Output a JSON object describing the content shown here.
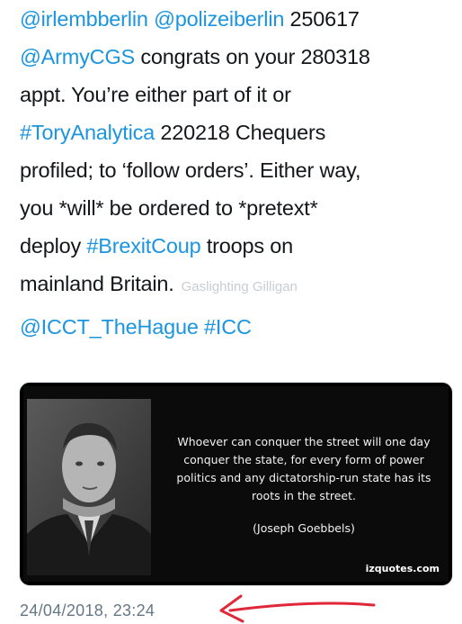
{
  "tweet": {
    "lines": [
      [
        {
          "t": "@irlembberlin",
          "link": true
        },
        {
          "t": " "
        },
        {
          "t": "@polizeiberlin",
          "link": true
        },
        {
          "t": " 250617"
        }
      ],
      [
        {
          "t": "@ArmyCGS",
          "link": true
        },
        {
          "t": " congrats on your 280318"
        }
      ],
      [
        {
          "t": "appt. You’re either part of it or"
        }
      ],
      [
        {
          "t": "#ToryAnalytica",
          "link": true
        },
        {
          "t": " 220218 Chequers"
        }
      ],
      [
        {
          "t": "profiled; to ‘follow orders’. Either way,"
        }
      ],
      [
        {
          "t": "you *will* be ordered to *pretext*"
        }
      ],
      [
        {
          "t": "deploy "
        },
        {
          "t": "#BrexitCoup",
          "link": true
        },
        {
          "t": " troops on"
        }
      ],
      [
        {
          "t": "mainland Britain."
        },
        {
          "t": "Gaslighting Gilligan",
          "watermark": true
        }
      ],
      [
        {
          "t": "@ICCT_TheHague",
          "link": true
        },
        {
          "t": " "
        },
        {
          "t": "#ICC",
          "link": true
        }
      ]
    ]
  },
  "media": {
    "quote_text": "Whoever can conquer the street will one day conquer the state, for every form of power politics and any dictatorship-run state has its roots in the street.",
    "attribution": "(Joseph Goebbels)",
    "source": "izquotes.com"
  },
  "timestamp": "24/04/2018, 23:24",
  "colors": {
    "link": "#1b95e0",
    "text": "#14171a",
    "meta": "#657786",
    "arrow": "#e0283a"
  }
}
